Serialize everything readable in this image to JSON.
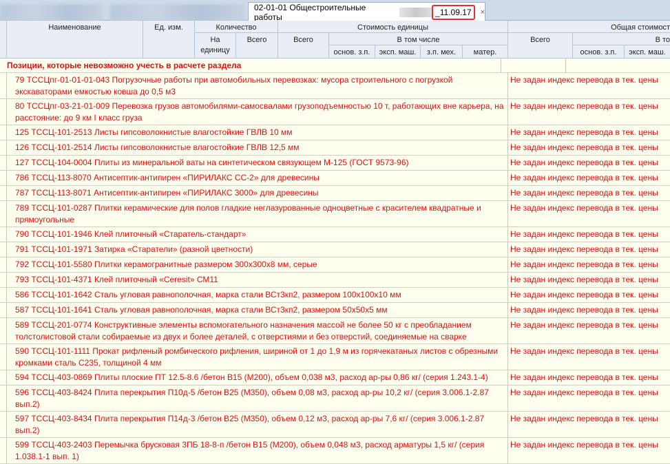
{
  "tab": {
    "title_prefix": "02-01-01 Общестроительные работы_",
    "title_suffix": "_11.09.17",
    "close": "×"
  },
  "header": {
    "name": "Наименование",
    "unit": "Ед. изм.",
    "qty": "Количество",
    "qty_per": "На единицу",
    "qty_total": "Всего",
    "unit_cost": "Стоимость единицы",
    "uc_total": "Всего",
    "uc_incl": "В том числе",
    "osn_zp": "основ. з.п.",
    "eksp_mash": "эксп. маш.",
    "zp_meh": "з.п. мех.",
    "mater": "матер.",
    "total_cost": "Общая стоимост",
    "tc_total": "Всего",
    "tc_incl": "В то",
    "tc_osn": "основ. з.п.",
    "tc_eksp": "эксп. маш."
  },
  "section": "Позиции, которые невозможно учесть в расчете раздела",
  "error_text": "Не задан индекс перевода в тек. цены",
  "rows": [
    "79 ТССЦпг-01-01-01-043 Погрузочные работы при автомобильных перевозках: мусора строительного с погрузкой экскаваторами емкостью ковша до 0,5 м3",
    "80 ТССЦпг-03-21-01-009 Перевозка грузов автомобилями-самосвалами грузоподъемностью 10 т, работающих вне карьера, на расстояние: до 9 км I класс груза",
    "125 ТССЦ-101-2513 Листы гипсоволокнистые влагостойкие ГВЛВ 10 мм",
    "126 ТССЦ-101-2514 Листы гипсоволокнистые влагостойкие ГВЛВ 12,5 мм",
    "127 ТССЦ-104-0004 Плиты из минеральной ваты на синтетическом связующем М-125 (ГОСТ 9573-96)",
    "786 ТССЦ-113-8070 Антисептик-антипирен «ПИРИЛАКС СС-2» для древесины",
    "787 ТССЦ-113-8071 Антисептик-антипирен «ПИРИЛАКС 3000» для древесины",
    "789 ТССЦ-101-0287 Плитки керамические для полов гладкие неглазурованные одноцветные с красителем квадратные и прямоугольные",
    "790 ТССЦ-101-1946 Клей плиточный «Старатель-стандарт»",
    "791 ТССЦ-101-1971 Затирка «Старатели» (разной цветности)",
    "792 ТССЦ-101-5580 Плитки керамогранитные размером 300х300х8 мм, серые",
    "793 ТССЦ-101-4371 Клей плиточный «Ceresit» СМ11",
    "586 ТССЦ-101-1642 Сталь угловая равнополочная, марка стали ВСт3кп2, размером 100х100х10 мм",
    "587 ТССЦ-101-1641 Сталь угловая равнополочная, марка стали ВСт3кп2, размером 50х50х5 мм",
    "589 ТССЦ-201-0774 Конструктивные элементы вспомогательного назначения массой не более 50 кг с преобладанием толстолистовой стали собираемые из двух и более деталей, с отверстиями и без отверстий, соединяемые на сварке",
    "590 ТССЦ-101-1111 Прокат рифленый ромбического рифления, шириной от 1 до 1,9 м из горячекатаных листов с обрезными кромками сталь С235, толщиной 4 мм",
    "594 ТССЦ-403-0869 Плиты плоские ПТ 12.5-8.6 /бетон В15 (М200), объем 0,038 м3, расход ар-ры 0,86 кг/ (серия 1.243.1-4)",
    "596 ТССЦ-403-8424 Плита перекрытия П10д-5 /бетон В25 (М350), объем 0,08 м3, расход ар-ры 10,2 кг/ (серия 3.006.1-2.87 вып.2)",
    "597 ТССЦ-403-8434 Плита перекрытия П14д-3 /бетон В25 (М350), объем 0,12 м3, расход ар-ры 7,6 кг/ (серия 3.006.1-2.87 вып.2)",
    "599 ТССЦ-403-2403 Перемычка брусковая 3ПБ 18-8-п /бетон В15 (М200), объем 0,048 м3, расход арматуры 1,5 кг/ (серия 1.038.1-1 вып. 1)"
  ]
}
